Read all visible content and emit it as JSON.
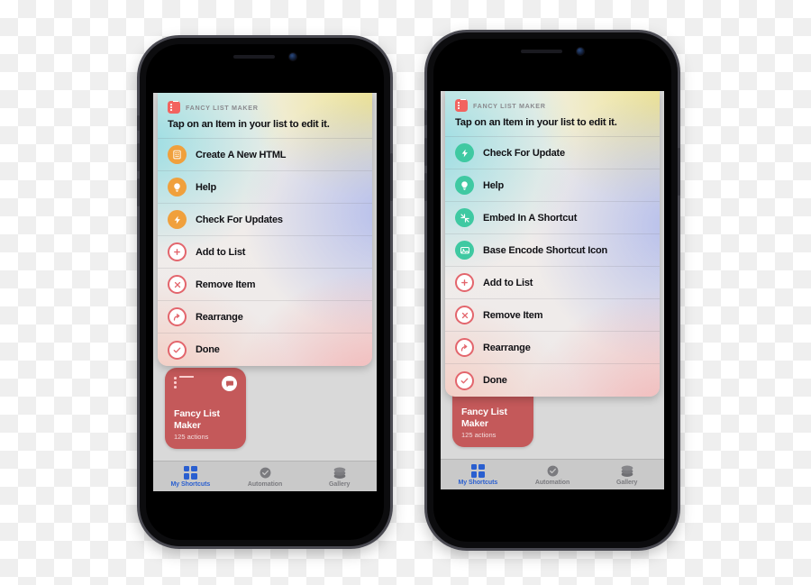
{
  "background": {
    "type": "transparent-checkerboard"
  },
  "theme": {
    "accent_blue": "#2a5fd0",
    "icon_orange": "#f0a03c",
    "icon_green": "#3fc9a2",
    "icon_red_outline": "#e3656c",
    "card_red": "#c4595a",
    "app_icon_red": "#f2635f",
    "tabbar_gray": "#c9c9c9",
    "screen_gray": "#d9d9d9"
  },
  "phones": [
    {
      "id": "left",
      "sheet": {
        "app_icon": "list-app-icon",
        "app_name": "FANCY LIST MAKER",
        "prompt": "Tap on an Item in your list to edit it.",
        "rows": [
          {
            "icon": "document-icon",
            "icon_style": "orange",
            "label": "Create A New HTML"
          },
          {
            "icon": "lightbulb-icon",
            "icon_style": "orange",
            "label": "Help"
          },
          {
            "icon": "bolt-icon",
            "icon_style": "orange",
            "label": "Check For Updates"
          },
          {
            "icon": "plus-circle-icon",
            "icon_style": "redout",
            "label": "Add to List"
          },
          {
            "icon": "x-circle-icon",
            "icon_style": "redout",
            "label": "Remove Item"
          },
          {
            "icon": "arrow-curve-icon",
            "icon_style": "redout",
            "label": "Rearrange"
          },
          {
            "icon": "check-circle-icon",
            "icon_style": "redout",
            "label": "Done"
          }
        ]
      },
      "shortcut_card": {
        "icon": "bulleted-list-icon",
        "badge_icon": "speech-bubble-icon",
        "title": "Fancy List Maker",
        "subtitle": "125 actions"
      },
      "tabbar": [
        {
          "icon": "grid-squares-icon",
          "label": "My Shortcuts",
          "active": true
        },
        {
          "icon": "clock-check-icon",
          "label": "Automation",
          "active": false
        },
        {
          "icon": "layers-icon",
          "label": "Gallery",
          "active": false
        }
      ]
    },
    {
      "id": "right",
      "sheet": {
        "app_icon": "list-app-icon",
        "app_name": "FANCY LIST MAKER",
        "prompt": "Tap on an Item in your list to edit it.",
        "rows": [
          {
            "icon": "bolt-icon",
            "icon_style": "green",
            "label": "Check For Update"
          },
          {
            "icon": "lightbulb-icon",
            "icon_style": "green",
            "label": "Help"
          },
          {
            "icon": "arrows-inward-icon",
            "icon_style": "green",
            "label": "Embed In A Shortcut"
          },
          {
            "icon": "image-icon",
            "icon_style": "green",
            "label": "Base Encode Shortcut Icon"
          },
          {
            "icon": "plus-circle-icon",
            "icon_style": "redout",
            "label": "Add to List"
          },
          {
            "icon": "x-circle-icon",
            "icon_style": "redout",
            "label": "Remove Item"
          },
          {
            "icon": "arrow-curve-icon",
            "icon_style": "redout",
            "label": "Rearrange"
          },
          {
            "icon": "check-circle-icon",
            "icon_style": "redout",
            "label": "Done"
          }
        ]
      },
      "shortcut_card": {
        "icon": "bulleted-list-icon",
        "badge_icon": "speech-bubble-icon",
        "title": "Fancy List Maker",
        "subtitle": "125 actions"
      },
      "tabbar": [
        {
          "icon": "grid-squares-icon",
          "label": "My Shortcuts",
          "active": true
        },
        {
          "icon": "clock-check-icon",
          "label": "Automation",
          "active": false
        },
        {
          "icon": "layers-icon",
          "label": "Gallery",
          "active": false
        }
      ]
    }
  ]
}
